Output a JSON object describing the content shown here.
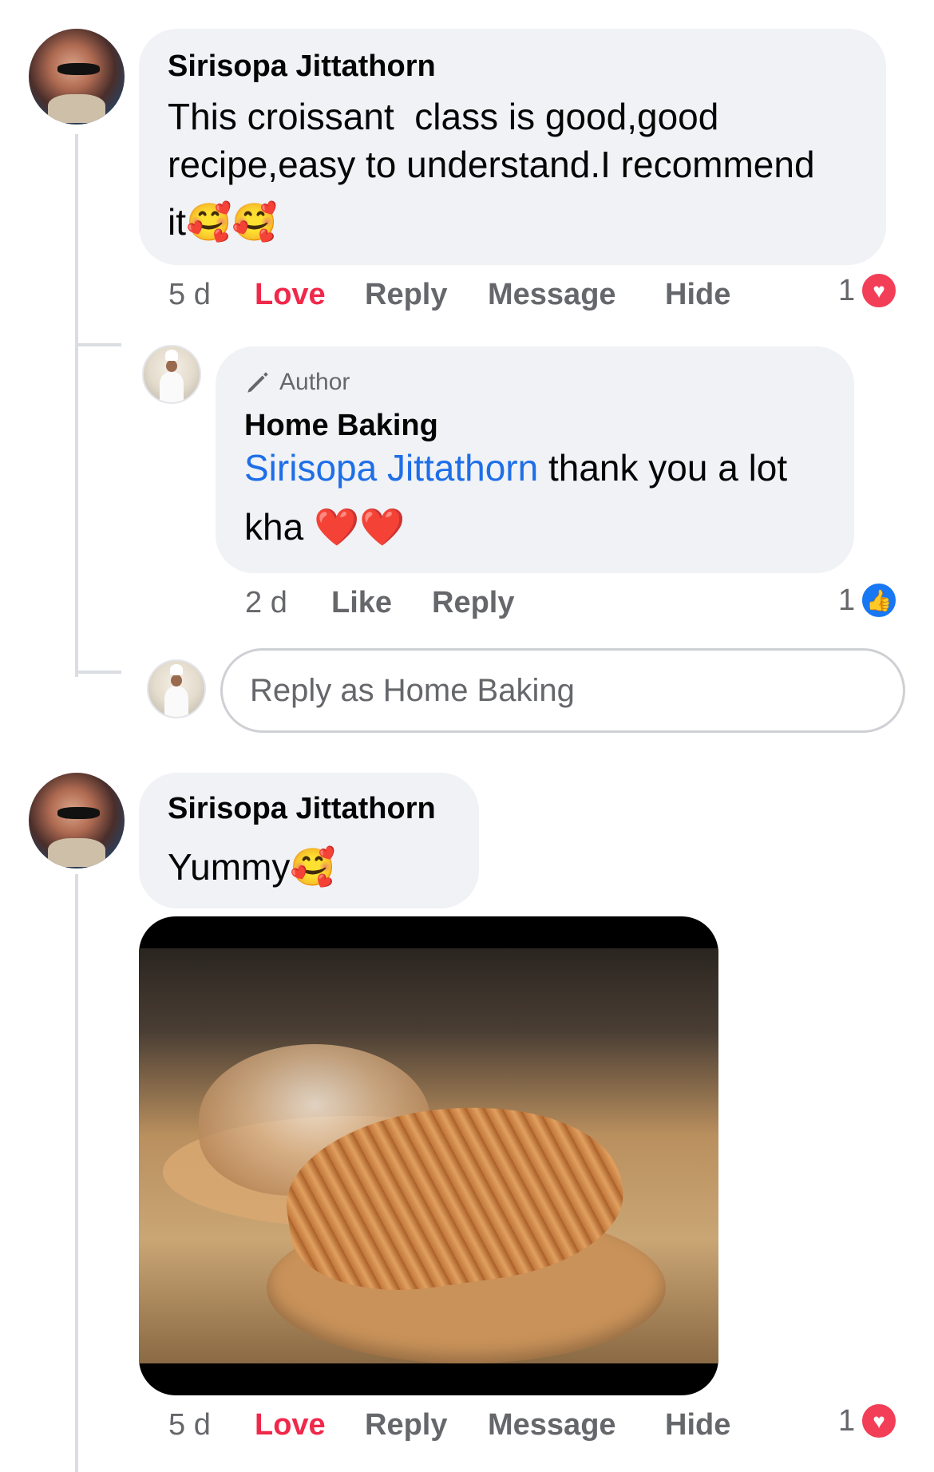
{
  "comment1": {
    "author": "Sirisopa Jittathorn",
    "text_line1": "This croissant  class is good,good",
    "text_line2": "recipe,easy to understand.I recommend",
    "text_line3": "it🥰🥰",
    "time": "5 d",
    "actions": [
      "Love",
      "Reply",
      "Message",
      "Hide"
    ],
    "reaction_count": "1",
    "reaction_icon": "heart-icon"
  },
  "reply1": {
    "badge": "Author",
    "badge_icon": "pen-icon",
    "author": "Home Baking",
    "mention": "Sirisopa Jittathorn",
    "text_after_mention": " thank you a lot",
    "text_line2": "kha ❤️❤️",
    "time": "2 d",
    "actions": [
      "Like",
      "Reply"
    ],
    "reaction_count": "1",
    "reaction_icon": "thumbs-up-icon"
  },
  "reply_box": {
    "placeholder": "Reply as Home Baking"
  },
  "comment2": {
    "author": "Sirisopa Jittathorn",
    "text": "Yummy🥰",
    "image_alt": "croissant photo",
    "time": "5 d",
    "actions": [
      "Love",
      "Reply",
      "Message",
      "Hide"
    ],
    "reaction_count": "1",
    "reaction_icon": "heart-icon"
  },
  "colors": {
    "bubble_bg": "#f0f2f5",
    "love_red": "#f0284a",
    "link_blue": "#1e6ee8",
    "like_blue": "#1877f2",
    "meta_grey": "#65676b"
  }
}
